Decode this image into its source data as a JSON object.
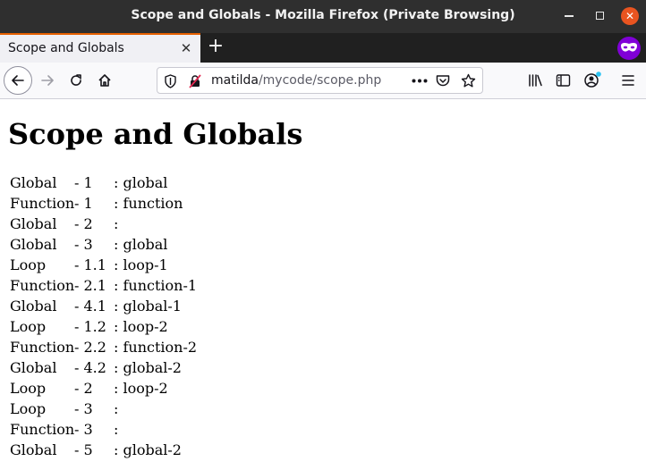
{
  "window": {
    "title": "Scope and Globals - Mozilla Firefox (Private Browsing)"
  },
  "tabs": [
    {
      "label": "Scope and Globals"
    }
  ],
  "navbar": {
    "url_host": "matilda",
    "url_path": "/mycode/scope.php",
    "icons": [
      "back-arrow-icon",
      "forward-arrow-icon",
      "reload-icon",
      "home-icon",
      "shield-icon",
      "insecure-lock-icon",
      "more-dots-icon",
      "pocket-icon",
      "star-icon",
      "library-icon",
      "sidebar-icon",
      "account-icon",
      "menu-icon"
    ]
  },
  "page": {
    "heading": "Scope and Globals",
    "rows": [
      {
        "scope": "Global",
        "num": "- 1",
        "value": ": global"
      },
      {
        "scope": "Function",
        "num": "- 1",
        "value": ": function"
      },
      {
        "scope": "Global",
        "num": "- 2",
        "value": ":"
      },
      {
        "scope": "Global",
        "num": "- 3",
        "value": ": global"
      },
      {
        "scope": "Loop",
        "num": "- 1.1",
        "value": ": loop-1"
      },
      {
        "scope": "Function",
        "num": "- 2.1",
        "value": ": function-1"
      },
      {
        "scope": "Global",
        "num": "- 4.1",
        "value": ": global-1"
      },
      {
        "scope": "Loop",
        "num": "- 1.2",
        "value": ": loop-2"
      },
      {
        "scope": "Function",
        "num": "- 2.2",
        "value": ": function-2"
      },
      {
        "scope": "Global",
        "num": "- 4.2",
        "value": ": global-2"
      },
      {
        "scope": "Loop",
        "num": "- 2",
        "value": ": loop-2"
      },
      {
        "scope": "Loop",
        "num": "- 3",
        "value": ":"
      },
      {
        "scope": "Function",
        "num": "- 3",
        "value": ":"
      },
      {
        "scope": "Global",
        "num": "- 5",
        "value": ": global-2"
      }
    ]
  },
  "colors": {
    "titlebar": "#2f2f2f",
    "close_button": "#e95420",
    "tab_accent": "#e66000",
    "private_badge": "#8000d7"
  }
}
